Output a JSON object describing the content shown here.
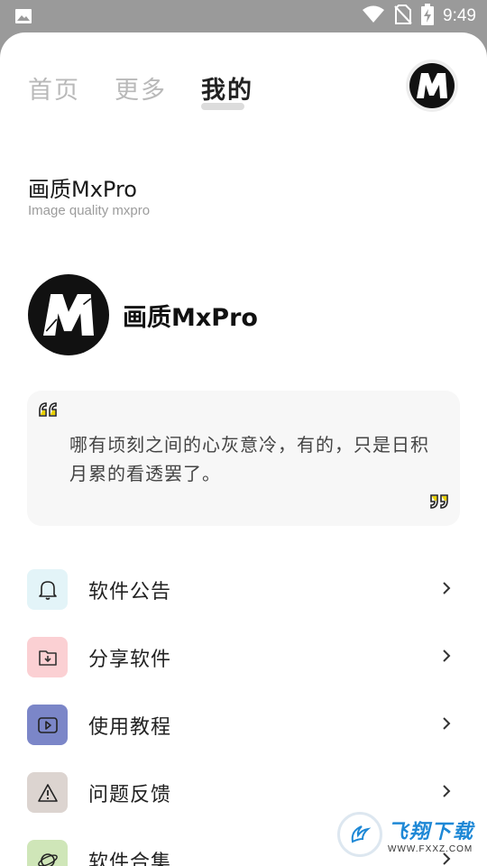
{
  "status_bar": {
    "time": "9:49"
  },
  "tabs": [
    {
      "label": "首页",
      "active": false
    },
    {
      "label": "更多",
      "active": false
    },
    {
      "label": "我的",
      "active": true
    }
  ],
  "app": {
    "title": "画质MxPro",
    "subtitle": "Image quality mxpro"
  },
  "profile": {
    "name": "画质MxPro",
    "logo_letter": "M"
  },
  "quote": {
    "text": "哪有顷刻之间的心灰意冷，有的，只是日积月累的看透罢了。"
  },
  "menu": [
    {
      "label": "软件公告",
      "icon": "bell-icon",
      "icon_bg": "#e3f4f8"
    },
    {
      "label": "分享软件",
      "icon": "folder-download-icon",
      "icon_bg": "#fbd0d3"
    },
    {
      "label": "使用教程",
      "icon": "video-play-icon",
      "icon_bg": "#7b86c8"
    },
    {
      "label": "问题反馈",
      "icon": "warning-icon",
      "icon_bg": "#dcd4d0"
    },
    {
      "label": "软件合集",
      "icon": "planet-icon",
      "icon_bg": "#cfe6b8"
    }
  ],
  "watermark": {
    "name": "飞翔下载",
    "url": "WWW.FXXZ.COM"
  },
  "colors": {
    "status_bar": "#9a9a9a",
    "card_bg": "#f7f7f7",
    "text_primary": "#222222",
    "text_muted": "#b9b9b9"
  }
}
